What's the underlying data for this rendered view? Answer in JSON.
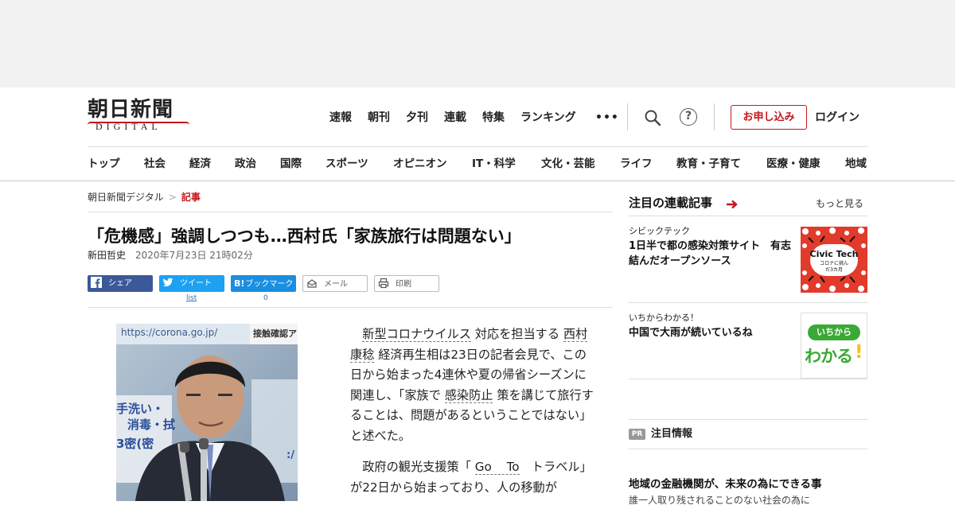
{
  "logo": {
    "ja": "朝日新聞",
    "en": "DIGITAL"
  },
  "topnav": [
    "速報",
    "朝刊",
    "夕刊",
    "連載",
    "特集",
    "ランキング"
  ],
  "more": "•••",
  "help": "?",
  "subscribe": "お申し込み",
  "login": "ログイン",
  "categories": [
    "トップ",
    "社会",
    "経済",
    "政治",
    "国際",
    "スポーツ",
    "オピニオン",
    "IT・科学",
    "文化・芸能",
    "ライフ",
    "教育・子育て",
    "医療・健康",
    "地域"
  ],
  "breadcrumb": {
    "home": "朝日新聞デジタル",
    "sep": ">",
    "current": "記事"
  },
  "article": {
    "title": "「危機感」強調しつつも…西村氏「家族旅行は問題ない」",
    "author": "新田哲史",
    "date": "2020年7月23日 21時02分",
    "photo_text": {
      "url": "https://corona.go.jp/",
      "sign": "接触確認ア",
      "banner1": "手洗い・",
      "banner2": "消毒・拭",
      "banner3": "3密(密",
      "side": ":/"
    },
    "p1": {
      "kw1": "新型コロナウイルス",
      "t1": "対応を担当する",
      "kw2": "西村康稔",
      "t2": "経済再生相は23日の記者会見で、この日から始まった4連休や夏の帰省シーズンに関連し、「家族で",
      "kw3": "感染防止",
      "t3": "策を講じて旅行することは、問題があるということではない」と述べた。"
    },
    "p2": {
      "t1": "政府の観光支援策「",
      "kw1": "Go To",
      "t2": "トラベル」が22日から始まっており、人の移動が"
    }
  },
  "share": {
    "facebook": "シェア",
    "twitter": "ツイート",
    "twitter_count": "list",
    "hatena": "ブックマーク",
    "hatena_icon": "B!",
    "hatena_count": "0",
    "mail": "メール",
    "print": "印刷"
  },
  "sidebar": {
    "heading": "注目の連載記事",
    "more": "もっと見る",
    "items": [
      {
        "category": "シビックテック",
        "title": "1日半で都の感染対策サイト　有志結んだオープンソース",
        "thumb_title": "Civic Tech",
        "thumb_sub": "コロナに挑んだ3カ月"
      },
      {
        "category": "いちからわかる！",
        "title": "中国で大雨が続いているね",
        "thumb_top": "いちから",
        "thumb_main": "わかる",
        "thumb_bang": "!"
      }
    ],
    "pr": {
      "badge": "PR",
      "label": "注目情報",
      "title": "地域の金融機関が、未来の為にできる事",
      "sub": "誰一人取り残されることのない社会の為に"
    }
  },
  "colors": {
    "brand_red": "#c4161c",
    "facebook": "#3b5998",
    "twitter": "#1da1f2",
    "hatena": "#1a8ee1",
    "ichikara_green": "#3aa935"
  }
}
